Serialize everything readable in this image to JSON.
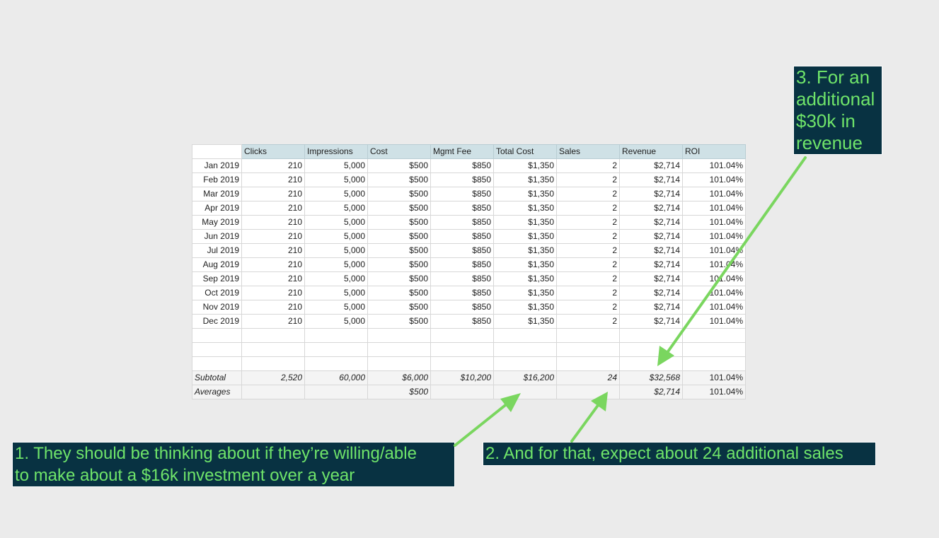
{
  "table": {
    "columns": [
      "",
      "Clicks",
      "Impressions",
      "Cost",
      "Mgmt Fee",
      "Total Cost",
      "Sales",
      "Revenue",
      "ROI"
    ],
    "rows": [
      [
        "Jan 2019",
        "210",
        "5,000",
        "$500",
        "$850",
        "$1,350",
        "2",
        "$2,714",
        "101.04%"
      ],
      [
        "Feb 2019",
        "210",
        "5,000",
        "$500",
        "$850",
        "$1,350",
        "2",
        "$2,714",
        "101.04%"
      ],
      [
        "Mar 2019",
        "210",
        "5,000",
        "$500",
        "$850",
        "$1,350",
        "2",
        "$2,714",
        "101.04%"
      ],
      [
        "Apr 2019",
        "210",
        "5,000",
        "$500",
        "$850",
        "$1,350",
        "2",
        "$2,714",
        "101.04%"
      ],
      [
        "May 2019",
        "210",
        "5,000",
        "$500",
        "$850",
        "$1,350",
        "2",
        "$2,714",
        "101.04%"
      ],
      [
        "Jun 2019",
        "210",
        "5,000",
        "$500",
        "$850",
        "$1,350",
        "2",
        "$2,714",
        "101.04%"
      ],
      [
        "Jul 2019",
        "210",
        "5,000",
        "$500",
        "$850",
        "$1,350",
        "2",
        "$2,714",
        "101.04%"
      ],
      [
        "Aug 2019",
        "210",
        "5,000",
        "$500",
        "$850",
        "$1,350",
        "2",
        "$2,714",
        "101.04%"
      ],
      [
        "Sep 2019",
        "210",
        "5,000",
        "$500",
        "$850",
        "$1,350",
        "2",
        "$2,714",
        "101.04%"
      ],
      [
        "Oct 2019",
        "210",
        "5,000",
        "$500",
        "$850",
        "$1,350",
        "2",
        "$2,714",
        "101.04%"
      ],
      [
        "Nov 2019",
        "210",
        "5,000",
        "$500",
        "$850",
        "$1,350",
        "2",
        "$2,714",
        "101.04%"
      ],
      [
        "Dec 2019",
        "210",
        "5,000",
        "$500",
        "$850",
        "$1,350",
        "2",
        "$2,714",
        "101.04%"
      ]
    ],
    "subtotal": [
      "Subtotal",
      "2,520",
      "60,000",
      "$6,000",
      "$10,200",
      "$16,200",
      "24",
      "$32,568",
      "101.04%"
    ],
    "averages": [
      "Averages",
      "",
      "",
      "$500",
      "",
      "",
      "",
      "$2,714",
      "101.04%"
    ]
  },
  "callouts": {
    "one": [
      "1. They should be thinking about if they’re willing/able",
      "to make about a $16k investment over a year"
    ],
    "two": [
      "2. And for that, expect about 24 additional sales"
    ],
    "three": [
      "3. For an",
      "additional",
      "$30k in",
      "revenue"
    ]
  },
  "colors": {
    "callout_bg": "#083242",
    "callout_text": "#6fe46a",
    "arrow": "#7ad65f",
    "header_bg": "#cfe1e6"
  }
}
